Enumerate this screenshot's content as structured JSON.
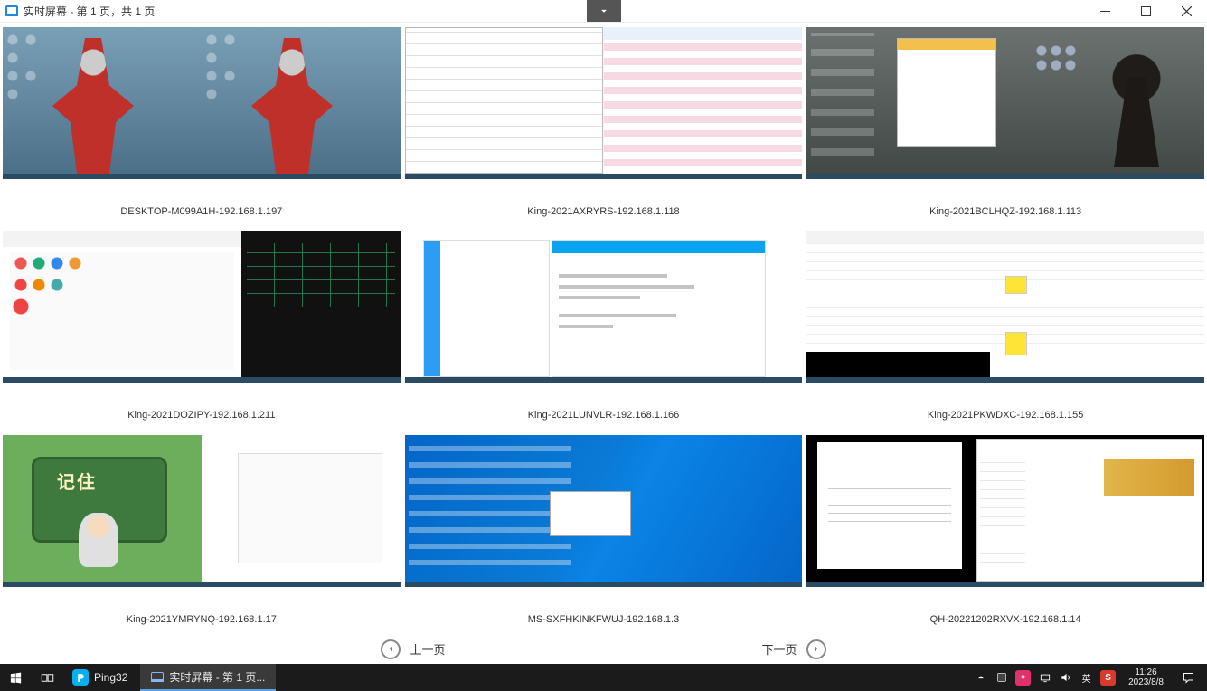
{
  "window": {
    "title": "实时屏幕 - 第 1 页，共 1 页"
  },
  "thumbs": [
    {
      "label": "DESKTOP-M099A1H-192.168.1.197"
    },
    {
      "label": "King-2021AXRYRS-192.168.1.118"
    },
    {
      "label": "King-2021BCLHQZ-192.168.1.113"
    },
    {
      "label": "King-2021DOZIPY-192.168.1.211"
    },
    {
      "label": "King-2021LUNVLR-192.168.1.166"
    },
    {
      "label": "King-2021PKWDXC-192.168.1.155"
    },
    {
      "label": "King-2021YMRYNQ-192.168.1.17"
    },
    {
      "label": "MS-SXFHKINKFWUJ-192.168.1.3"
    },
    {
      "label": "QH-20221202RXVX-192.168.1.14"
    }
  ],
  "thumb7_board_text": "记住",
  "pager": {
    "prev": "上一页",
    "next": "下一页"
  },
  "taskbar": {
    "app_ping": "Ping32",
    "app_running": "实时屏幕 - 第 1 页...",
    "ime1": "英",
    "ime2": "S",
    "time": "11:26",
    "date": "2023/8/8"
  }
}
